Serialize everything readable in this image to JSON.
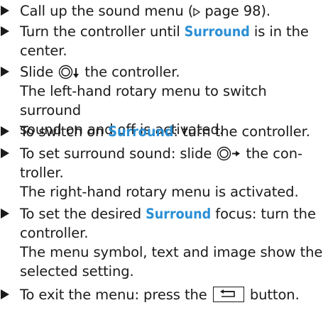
{
  "steps": [
    {
      "line1_a": "Call up the sound menu (",
      "line1_ref": "page 98",
      "line1_b": ")."
    },
    {
      "line1_a": "Turn the controller until ",
      "line1_hl": "Surround",
      "line1_b": " is in the",
      "line2": "center."
    },
    {
      "line1_a": "Slide ",
      "line1_b": " the controller.",
      "line2": "The left-hand rotary menu to switch surround",
      "line3": "sound on and off is activated."
    },
    {
      "line1_a": "To switch on ",
      "line1_hl": "Surround",
      "line1_b": ": turn the controller."
    },
    {
      "line1_a": "To set surround sound: slide ",
      "line1_b": " the con-",
      "line2": "troller.",
      "line3": "The right-hand rotary menu is activated."
    },
    {
      "line1_a": "To set the desired ",
      "line1_hl": "Surround",
      "line1_b": " focus: turn the",
      "line2": "controller.",
      "line3": "The menu symbol, text and image show the",
      "line4": "selected setting."
    },
    {
      "line1_a": "To exit the menu: press the ",
      "line1_b": " button."
    }
  ],
  "icons": {
    "step_marker": "black-right-triangle-icon",
    "page_ref": "outline-right-triangle-icon",
    "controller_slide_down": "controller-slide-down-icon",
    "controller_slide_right": "controller-slide-right-icon",
    "back_button": "back-arrow-button-icon"
  },
  "colors": {
    "highlight": "#2a8fd4",
    "text": "#1a1a1a"
  }
}
